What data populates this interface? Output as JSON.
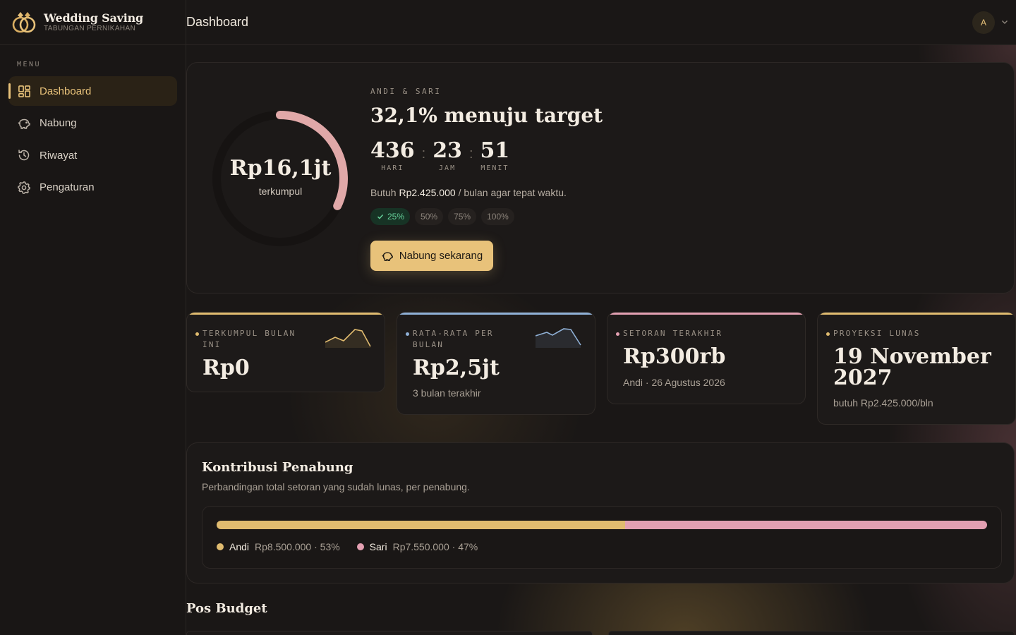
{
  "brand": {
    "title": "Wedding Saving",
    "subtitle": "TABUNGAN PERNIKAHAN"
  },
  "sidebar": {
    "menu_label": "MENU",
    "items": [
      {
        "label": "Dashboard",
        "icon": "dashboard-grid-icon",
        "active": true
      },
      {
        "label": "Nabung",
        "icon": "piggy-bank-icon",
        "active": false
      },
      {
        "label": "Riwayat",
        "icon": "history-icon",
        "active": false
      },
      {
        "label": "Pengaturan",
        "icon": "gear-icon",
        "active": false
      }
    ]
  },
  "header": {
    "title": "Dashboard",
    "avatar_initial": "A"
  },
  "hero": {
    "collected_amount": "Rp16,1jt",
    "collected_label": "terkumpul",
    "progress_fraction": 0.321,
    "couple": "ANDI & SARI",
    "progress_title": "32,1% menuju target",
    "countdown": [
      {
        "value": "436",
        "unit": "HARI"
      },
      {
        "value": "23",
        "unit": "JAM"
      },
      {
        "value": "51",
        "unit": "MENIT"
      }
    ],
    "need_prefix": "Butuh",
    "need_amount": "Rp2.425.000",
    "need_suffix": "/ bulan agar tepat waktu.",
    "milestones": [
      {
        "label": "25%",
        "done": true
      },
      {
        "label": "50%",
        "done": false
      },
      {
        "label": "75%",
        "done": false
      },
      {
        "label": "100%",
        "done": false
      }
    ],
    "cta_label": "Nabung sekarang"
  },
  "stats": [
    {
      "label": "TERKUMPUL BULAN INI",
      "value": "Rp0",
      "sub": "",
      "accent": "#e0bb6f"
    },
    {
      "label": "RATA-RATA PER BULAN",
      "value": "Rp2,5jt",
      "sub": "3 bulan terakhir",
      "accent": "#8fb0d6"
    },
    {
      "label": "SETORAN TERAKHIR",
      "value": "Rp300rb",
      "sub": "Andi · 26 Agustus 2026",
      "accent": "#e3a0b2"
    },
    {
      "label": "PROYEKSI LUNAS",
      "value": "19 November 2027",
      "sub": "butuh Rp2.425.000/bln",
      "accent": "#e0bb6f"
    }
  ],
  "contribution": {
    "title": "Kontribusi Penabung",
    "subtitle": "Perbandingan total setoran yang sudah lunas, per penabung.",
    "members": [
      {
        "name": "Andi",
        "detail": "Rp8.500.000 · 53%",
        "share": 0.53,
        "color": "#e0bb6f"
      },
      {
        "name": "Sari",
        "detail": "Rp7.550.000 · 47%",
        "share": 0.47,
        "color": "#e3a0b2"
      }
    ]
  },
  "budget": {
    "title": "Pos Budget"
  }
}
